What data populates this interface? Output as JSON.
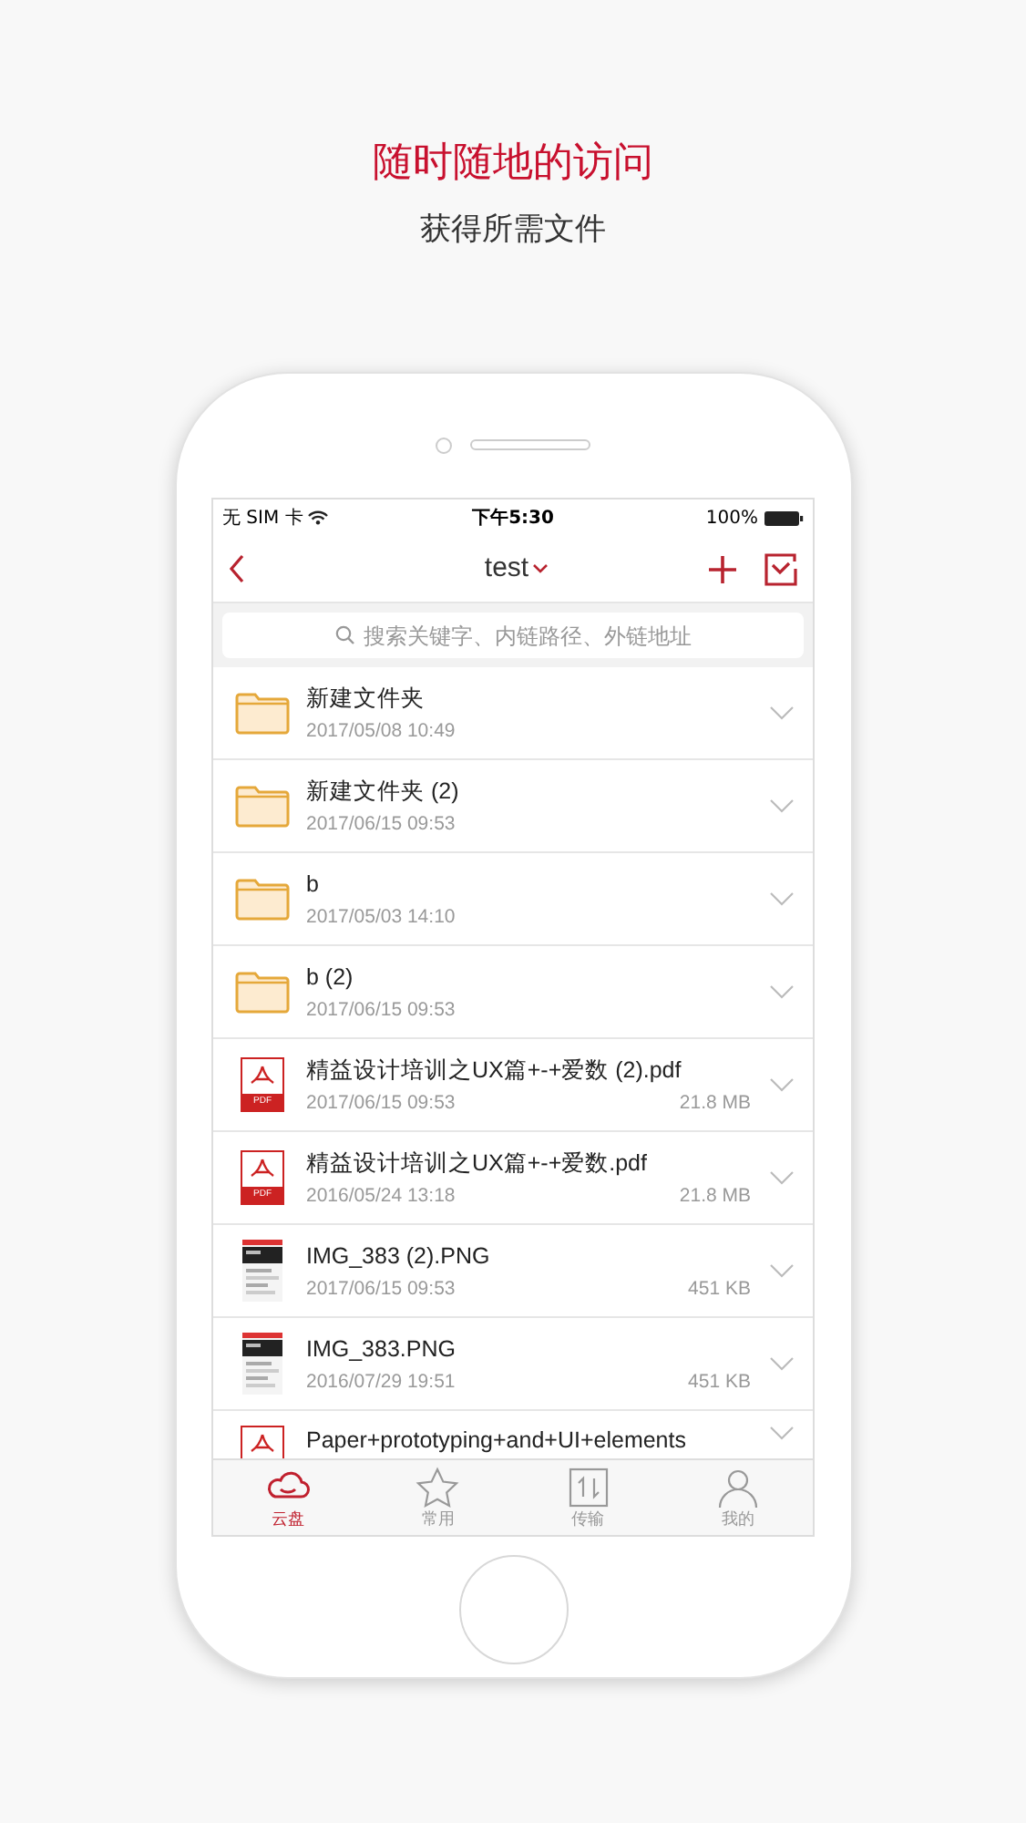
{
  "headline": "随时随地的访问",
  "subtitle": "获得所需文件",
  "status_bar": {
    "carrier": "无 SIM 卡",
    "time": "下午5:30",
    "battery": "100%"
  },
  "nav": {
    "title": "test"
  },
  "search": {
    "placeholder": "搜索关键字、内链路径、外链地址"
  },
  "files": [
    {
      "kind": "folder",
      "name": "新建文件夹",
      "date": "2017/05/08 10:49"
    },
    {
      "kind": "folder",
      "name": "新建文件夹 (2)",
      "date": "2017/06/15 09:53"
    },
    {
      "kind": "folder",
      "name": "b",
      "date": "2017/05/03 14:10"
    },
    {
      "kind": "folder",
      "name": "b (2)",
      "date": "2017/06/15 09:53"
    },
    {
      "kind": "pdf",
      "name": "精益设计培训之UX篇+-+爱数 (2).pdf",
      "date": "2017/06/15 09:53",
      "size": "21.8 MB",
      "badge": "PDF"
    },
    {
      "kind": "pdf",
      "name": "精益设计培训之UX篇+-+爱数.pdf",
      "date": "2016/05/24 13:18",
      "size": "21.8 MB",
      "badge": "PDF"
    },
    {
      "name": "IMG_383 (2).PNG",
      "date": "2017/06/15 09:53",
      "size": "451 KB"
    },
    {
      "name": "IMG_383.PNG",
      "date": "2016/07/29 19:51",
      "size": "451 KB"
    },
    {
      "kind": "pdf",
      "name": "Paper+prototyping+and+UI+elements"
    }
  ],
  "tab_bar": [
    {
      "kind": "cloud",
      "label": "云盘",
      "selected": true
    },
    {
      "kind": "star",
      "label": "常用",
      "selected": false
    },
    {
      "kind": "transfer",
      "label": "传输",
      "selected": false
    },
    {
      "kind": "person",
      "label": "我的",
      "selected": false
    }
  ]
}
